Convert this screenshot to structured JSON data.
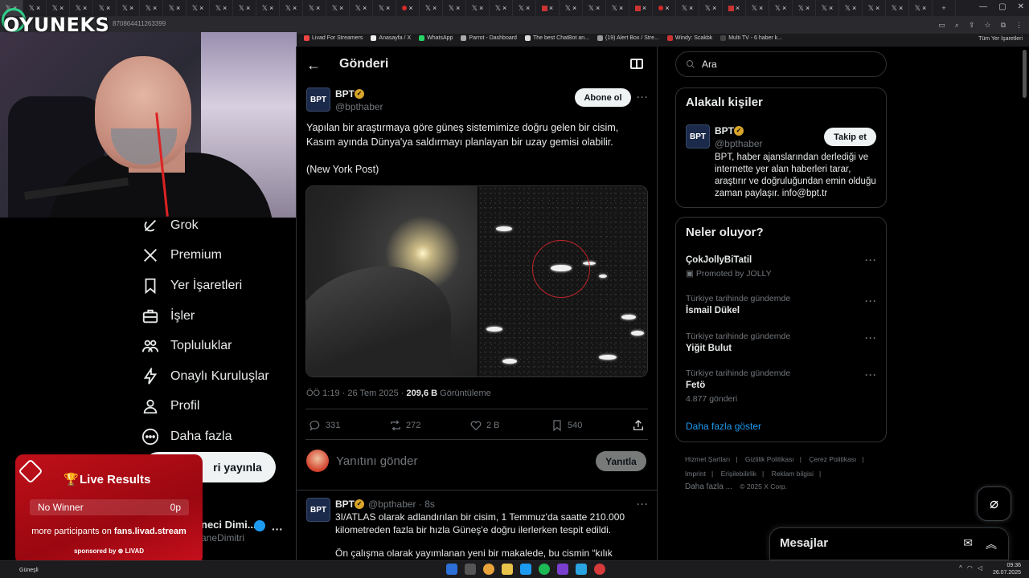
{
  "browser": {
    "url_fragment": "870864411263399",
    "bookmarks": [
      {
        "label": "Livad For Streamers",
        "color": "#e44"
      },
      {
        "label": "Anasayfa / X",
        "color": "#eee"
      },
      {
        "label": "WhatsApp",
        "color": "#25d366"
      },
      {
        "label": "Parrot - Dashboard",
        "color": "#aaa"
      },
      {
        "label": "The best ChatBot an...",
        "color": "#ddd"
      },
      {
        "label": "(19) Alert Box / Stre...",
        "color": "#999"
      },
      {
        "label": "Windy: Scakbk",
        "color": "#c33"
      },
      {
        "label": "Multi TV - 6 haber k...",
        "color": "#444"
      }
    ],
    "bookmarks_right": "Tüm Yer İşaretleri"
  },
  "overlay": {
    "logo": "OYUNEKS"
  },
  "live_widget": {
    "title": "Live Results",
    "row_label": "No Winner",
    "row_value": "0p",
    "more_prefix": "more participants on",
    "more_site": "fans.livad.stream",
    "sponsor": "sponsored by ⊛ LIVAD"
  },
  "nav": {
    "items": [
      {
        "label": "Grok",
        "icon": "grok-icon"
      },
      {
        "label": "Premium",
        "icon": "x-logo-icon"
      },
      {
        "label": "Yer İşaretleri",
        "icon": "bookmark-icon"
      },
      {
        "label": "İşler",
        "icon": "briefcase-icon"
      },
      {
        "label": "Topluluklar",
        "icon": "communities-icon"
      },
      {
        "label": "Onaylı Kuruluşlar",
        "icon": "lightning-icon"
      },
      {
        "label": "Profil",
        "icon": "person-icon"
      },
      {
        "label": "Daha fazla",
        "icon": "more-circle-icon"
      }
    ],
    "post_button": "ri yayınla",
    "account_name": "neci Dimi...",
    "account_handle": "aneDimitri"
  },
  "header": {
    "title": "Gönderi",
    "back": "←"
  },
  "post": {
    "name": "BPT",
    "handle": "@bpthaber",
    "subscribe": "Abone ol",
    "text": "Yapılan bir araştırmaya göre güneş sistemimize doğru gelen bir cisim, Kasım ayında Dünya'ya saldırmayı planlayan bir uzay gemisi olabilir.",
    "source": "(New York Post)",
    "time": "ÖÖ 1:19 · 26 Tem 2025 ·",
    "views": "209,6 B",
    "views_label": "Görüntüleme",
    "replies": "331",
    "reposts": "272",
    "likes": "2 B",
    "bookmarks": "540"
  },
  "reply": {
    "placeholder": "Yanıtını gönder",
    "button": "Yanıtla"
  },
  "post2": {
    "name": "BPT",
    "handle": "@bpthaber · 8s",
    "text": "3I/ATLAS olarak adlandırılan bir cisim, 1 Temmuz'da saatte 210.000 kilometreden fazla bir hızla Güneş'e doğru ilerlerken tespit edildi.",
    "text2": "Ön çalışma olarak yayımlanan yeni bir makalede, bu cismin “kılık"
  },
  "right": {
    "search_placeholder": "Ara",
    "related_title": "Alakalı kişiler",
    "related_name": "BPT",
    "related_handle": "@bpthaber",
    "follow": "Takip et",
    "bio": "BPT, haber ajanslarından derlediği ve internette yer alan haberleri tarar, araştırır ve doğruluğundan emin olduğu zaman paylaşır. info@bpt.tr",
    "trends_title": "Neler oluyor?",
    "trends": [
      {
        "cat": "",
        "name": "ÇokJollyBiTatil",
        "sub": "Promoted by JOLLY"
      },
      {
        "cat": "Türkiye tarihinde gündemde",
        "name": "İsmail Dükel",
        "sub": ""
      },
      {
        "cat": "Türkiye tarihinde gündemde",
        "name": "Yiğit Bulut",
        "sub": ""
      },
      {
        "cat": "Türkiye tarihinde gündemde",
        "name": "Fetö",
        "sub": "4.877 gönderi"
      }
    ],
    "show_more": "Daha fazla göster",
    "footer1": [
      "Hizmet Şartları",
      "Gizlilik Politikası",
      "Çerez Politikası"
    ],
    "footer2": [
      "Imprint",
      "Erişilebilirlik",
      "Reklam bilgisi"
    ],
    "footer3": [
      "Daha fazla ...",
      "© 2025 X Corp."
    ]
  },
  "messages": {
    "title": "Mesajlar"
  },
  "taskbar": {
    "weather": "Güneşli",
    "time": "09:36",
    "date": "26.07.2025"
  },
  "colors": {
    "accent": "#1d9bf0",
    "verified_gold": "#d9a52a",
    "widget_red": "#b00a14"
  }
}
